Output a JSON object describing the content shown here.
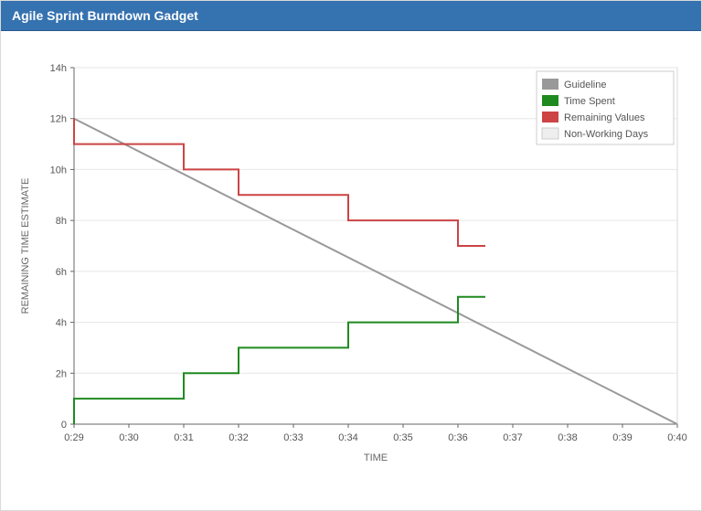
{
  "header": {
    "title": "Agile Sprint Burndown Gadget"
  },
  "chart_data": {
    "type": "line",
    "xlabel": "TIME",
    "ylabel": "REMAINING TIME ESTIMATE",
    "x_categories": [
      "0:29",
      "0:30",
      "0:31",
      "0:32",
      "0:33",
      "0:34",
      "0:35",
      "0:36",
      "0:37",
      "0:38",
      "0:39",
      "0:40"
    ],
    "y_ticks": [
      0,
      2,
      4,
      6,
      8,
      10,
      12,
      14
    ],
    "y_tick_labels": [
      "0",
      "2h",
      "4h",
      "6h",
      "8h",
      "10h",
      "12h",
      "14h"
    ],
    "ylim": [
      0,
      14
    ],
    "legend": {
      "position": "top-right",
      "items": [
        "Guideline",
        "Time Spent",
        "Remaining Values",
        "Non-Working Days"
      ]
    },
    "series": [
      {
        "name": "Guideline",
        "color": "#999999",
        "step": false,
        "points": [
          {
            "x": "0:29",
            "y": 12
          },
          {
            "x": "0:40",
            "y": 0
          }
        ]
      },
      {
        "name": "Time Spent",
        "color": "#1f8a1f",
        "step": true,
        "points": [
          {
            "x": "0:29",
            "y": 0
          },
          {
            "x": "0:29",
            "y": 1
          },
          {
            "x": "0:31",
            "y": 1
          },
          {
            "x": "0:31",
            "y": 2
          },
          {
            "x": "0:32",
            "y": 2
          },
          {
            "x": "0:32",
            "y": 3
          },
          {
            "x": "0:34",
            "y": 3
          },
          {
            "x": "0:34",
            "y": 4
          },
          {
            "x": "0:36",
            "y": 4
          },
          {
            "x": "0:36",
            "y": 5
          },
          {
            "x": "0:36.5",
            "y": 5
          }
        ]
      },
      {
        "name": "Remaining Values",
        "color": "#cc4444",
        "step": true,
        "points": [
          {
            "x": "0:29",
            "y": 12
          },
          {
            "x": "0:29",
            "y": 11
          },
          {
            "x": "0:31",
            "y": 11
          },
          {
            "x": "0:31",
            "y": 10
          },
          {
            "x": "0:32",
            "y": 10
          },
          {
            "x": "0:32",
            "y": 9
          },
          {
            "x": "0:34",
            "y": 9
          },
          {
            "x": "0:34",
            "y": 8
          },
          {
            "x": "0:36",
            "y": 8
          },
          {
            "x": "0:36",
            "y": 7
          },
          {
            "x": "0:36.5",
            "y": 7
          }
        ]
      },
      {
        "name": "Non-Working Days",
        "color": "#eeeeee",
        "step": false,
        "points": []
      }
    ]
  }
}
